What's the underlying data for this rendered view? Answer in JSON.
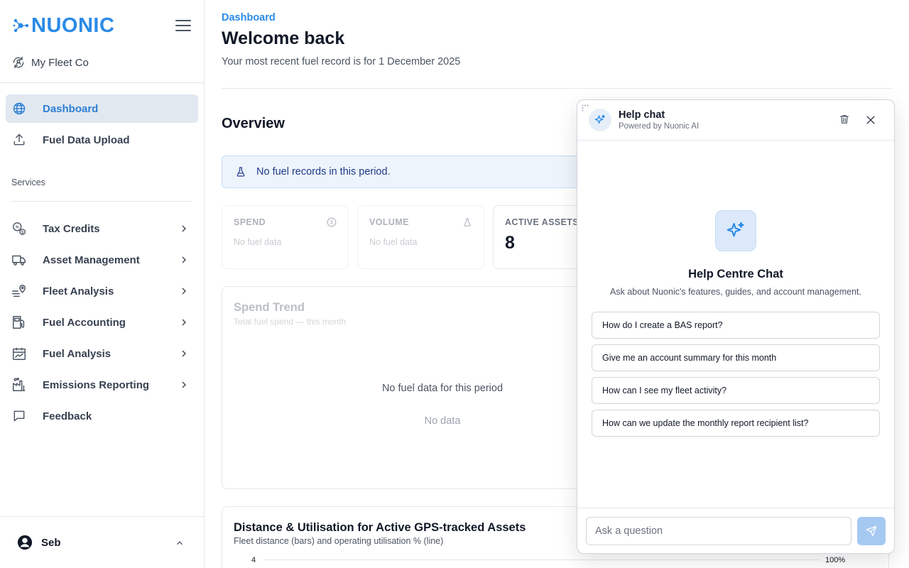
{
  "brand": {
    "logo_text": "NUONIC",
    "accent_color": "#2b8ae6"
  },
  "org": {
    "name": "My Fleet Co"
  },
  "sidebar": {
    "primary_items": [
      {
        "label": "Dashboard",
        "icon": "globe-icon",
        "active": true
      },
      {
        "label": "Fuel Data Upload",
        "icon": "upload-icon",
        "active": false
      }
    ],
    "services_label": "Services",
    "service_items": [
      {
        "label": "Tax Credits",
        "icon": "tax-credits-icon"
      },
      {
        "label": "Asset Management",
        "icon": "truck-icon"
      },
      {
        "label": "Fleet Analysis",
        "icon": "route-pin-icon"
      },
      {
        "label": "Fuel Accounting",
        "icon": "fuel-pump-icon"
      },
      {
        "label": "Fuel Analysis",
        "icon": "calendar-chart-icon"
      },
      {
        "label": "Emissions Reporting",
        "icon": "factory-icon"
      }
    ],
    "feedback_label": "Feedback",
    "user": {
      "name": "Seb"
    }
  },
  "header": {
    "breadcrumb": "Dashboard",
    "title": "Welcome back",
    "subtitle": "Your most recent fuel record is for 1 December 2025"
  },
  "overview": {
    "heading": "Overview",
    "alert": "No fuel records in this period.",
    "cards": [
      {
        "label": "SPEND",
        "value": "No fuel data",
        "icon": "dollar-icon"
      },
      {
        "label": "VOLUME",
        "value": "No fuel data",
        "icon": "flask-icon"
      },
      {
        "label": "ACTIVE ASSETS",
        "value": "8"
      }
    ]
  },
  "spend_trend": {
    "title": "Spend Trend",
    "subtitle": "Total fuel spend — this month",
    "empty_title": "No fuel data for this period",
    "empty_sub": "No data"
  },
  "distance_panel": {
    "title": "Distance & Utilisation for Active GPS-tracked Assets",
    "subtitle": "Fleet distance (bars) and operating utilisation % (line)",
    "y_left_top": "4",
    "y_right_top": "100%"
  },
  "chat": {
    "title": "Help chat",
    "powered_by": "Powered by Nuonic AI",
    "hero_title": "Help Centre Chat",
    "hero_desc": "Ask about Nuonic's features, guides, and account management.",
    "suggestions": [
      "How do I create a BAS report?",
      "Give me an account summary for this month",
      "How can I see my fleet activity?",
      "How can we update the monthly report recipient list?"
    ],
    "input_placeholder": "Ask a question"
  }
}
